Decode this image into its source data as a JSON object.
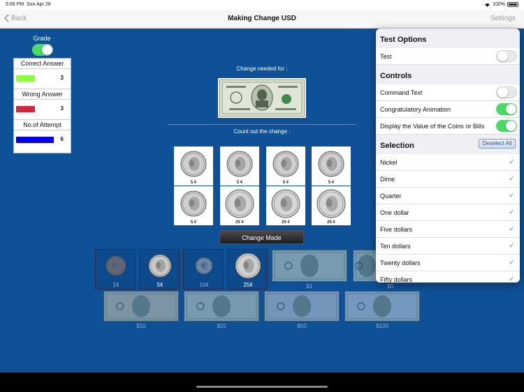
{
  "status_bar": {
    "time": "5:06 PM",
    "date": "Sun Apr 28",
    "battery": "100%"
  },
  "nav": {
    "back_label": "Back",
    "title": "Making Change USD",
    "settings_label": "Settings"
  },
  "grade": {
    "label": "Grade",
    "enabled": true,
    "rows": [
      {
        "label": "Correct Answer",
        "value": "3",
        "color": "#8cff3f",
        "bar_fraction": 0.5
      },
      {
        "label": "Wrong Answer",
        "value": "3",
        "color": "#d3263a",
        "bar_fraction": 0.5
      },
      {
        "label": "No.of Attempt",
        "value": "6",
        "color": "#0000ee",
        "bar_fraction": 1.0
      }
    ]
  },
  "prompt": {
    "needed_label": "Change needed for :",
    "count_label": "Count out the change :"
  },
  "slots": [
    {
      "value": "5 ¢",
      "coin": "nickel"
    },
    {
      "value": "5 ¢",
      "coin": "nickel"
    },
    {
      "value": "5 ¢",
      "coin": "nickel"
    },
    {
      "value": "5 ¢",
      "coin": "nickel"
    },
    {
      "value": "5 ¢",
      "coin": "nickel"
    },
    {
      "value": "25 ¢",
      "coin": "quarter"
    },
    {
      "value": "25 ¢",
      "coin": "quarter"
    },
    {
      "value": "25 ¢",
      "coin": "quarter"
    }
  ],
  "change_button": "Change Made",
  "tray_coins": [
    {
      "label": "1¢",
      "coin": "penny",
      "color": "#b07a55"
    },
    {
      "label": "5¢",
      "coin": "nickel",
      "color": "#c8c8c8"
    },
    {
      "label": "10¢",
      "coin": "dime",
      "color": "#bdbdbd"
    },
    {
      "label": "25¢",
      "coin": "quarter",
      "color": "#d0d0d0"
    }
  ],
  "tray_bills": [
    {
      "label": "$1"
    },
    {
      "label": "$5"
    },
    {
      "label": "$10"
    },
    {
      "label": "$20"
    },
    {
      "label": "$50"
    },
    {
      "label": "$100"
    }
  ],
  "settings": {
    "test_options_header": "Test Options",
    "test_label": "Test",
    "test_on": false,
    "controls_header": "Controls",
    "controls": [
      {
        "label": "Command Text",
        "on": false
      },
      {
        "label": "Congratulatory Animation",
        "on": true
      },
      {
        "label": "Display the Value of the Coins or Bills",
        "on": true
      }
    ],
    "selection_header": "Selection",
    "deselect_label": "Deselect All",
    "items": [
      {
        "label": "Nickel",
        "checked": true
      },
      {
        "label": "Dime",
        "checked": true
      },
      {
        "label": "Quarter",
        "checked": true
      },
      {
        "label": "One dollar",
        "checked": true
      },
      {
        "label": "Five dollars",
        "checked": true
      },
      {
        "label": "Ten dollars",
        "checked": true
      },
      {
        "label": "Twenty dollars",
        "checked": true
      },
      {
        "label": "Fifty dollars",
        "checked": true
      }
    ],
    "check_glyph": "✓"
  }
}
